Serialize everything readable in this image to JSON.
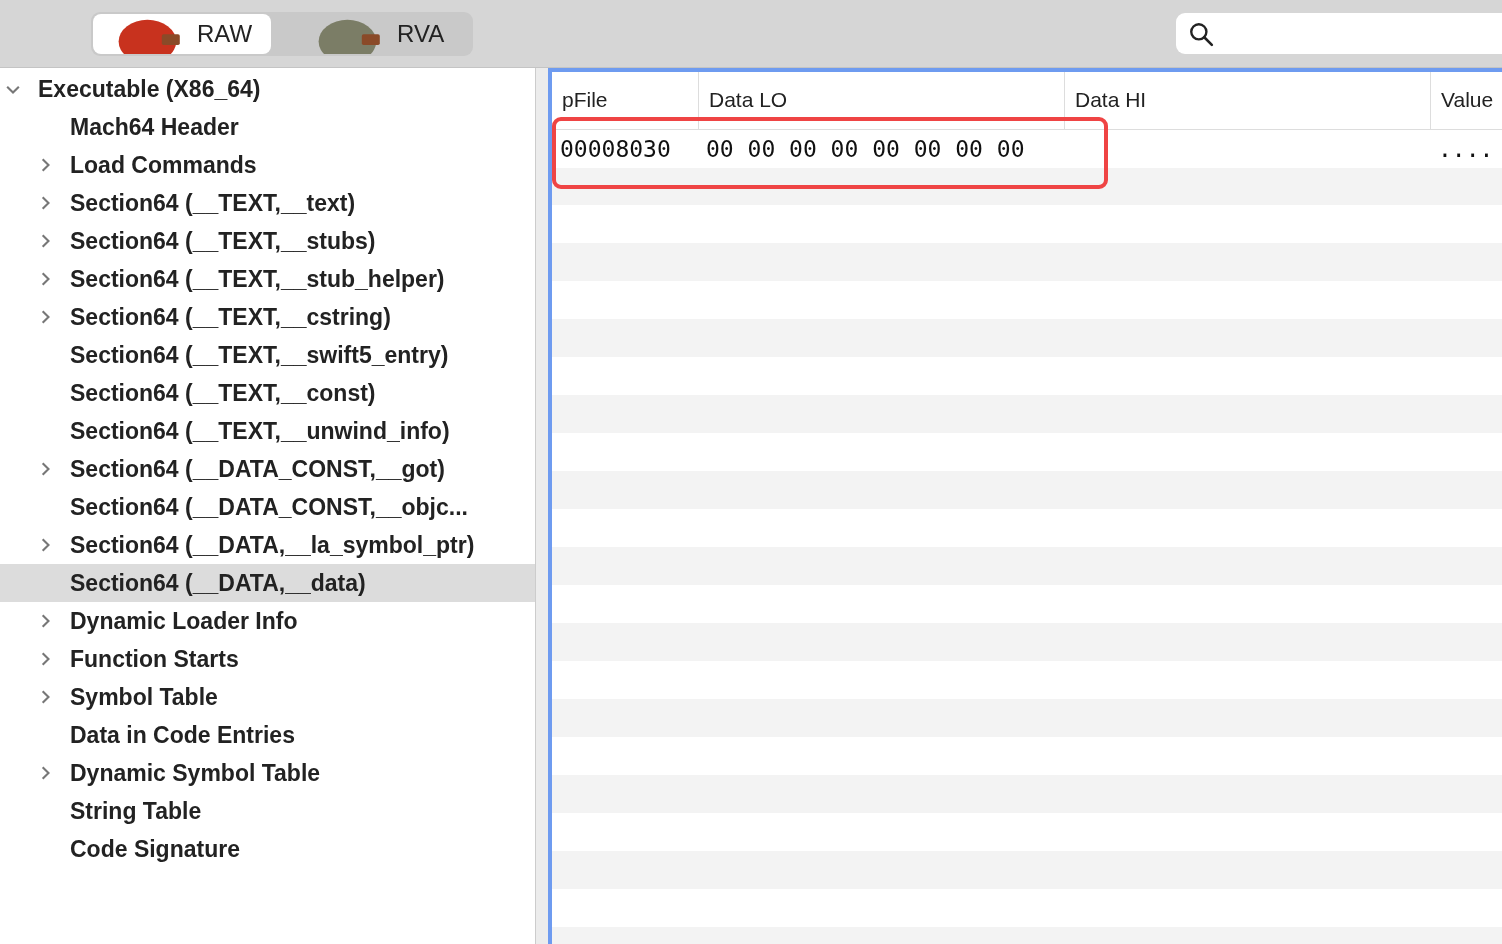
{
  "toolbar": {
    "segments": [
      {
        "label": "RAW",
        "selected": true
      },
      {
        "label": "RVA",
        "selected": false
      }
    ]
  },
  "tree": [
    {
      "label": "Executable  (X86_64)",
      "expanded": true,
      "selected": false,
      "children": [
        {
          "label": "Mach64 Header",
          "selected": false
        },
        {
          "label": "Load Commands",
          "expanded": false,
          "selected": false
        },
        {
          "label": "Section64 (__TEXT,__text)",
          "expanded": false,
          "selected": false
        },
        {
          "label": "Section64 (__TEXT,__stubs)",
          "expanded": false,
          "selected": false
        },
        {
          "label": "Section64 (__TEXT,__stub_helper)",
          "expanded": false,
          "selected": false
        },
        {
          "label": "Section64 (__TEXT,__cstring)",
          "expanded": false,
          "selected": false
        },
        {
          "label": "Section64 (__TEXT,__swift5_entry)",
          "selected": false
        },
        {
          "label": "Section64 (__TEXT,__const)",
          "selected": false
        },
        {
          "label": "Section64 (__TEXT,__unwind_info)",
          "selected": false
        },
        {
          "label": "Section64 (__DATA_CONST,__got)",
          "expanded": false,
          "selected": false
        },
        {
          "label": "Section64 (__DATA_CONST,__objc...",
          "selected": false
        },
        {
          "label": "Section64 (__DATA,__la_symbol_ptr)",
          "expanded": false,
          "selected": false
        },
        {
          "label": "Section64 (__DATA,__data)",
          "selected": true
        },
        {
          "label": "Dynamic Loader Info",
          "expanded": false,
          "selected": false
        },
        {
          "label": "Function Starts",
          "expanded": false,
          "selected": false
        },
        {
          "label": "Symbol Table",
          "expanded": false,
          "selected": false
        },
        {
          "label": "Data in Code Entries",
          "selected": false
        },
        {
          "label": "Dynamic Symbol Table",
          "expanded": false,
          "selected": false
        },
        {
          "label": "String Table",
          "selected": false
        },
        {
          "label": "Code Signature",
          "selected": false
        }
      ]
    }
  ],
  "table": {
    "columns": [
      "pFile",
      "Data LO",
      "Data HI",
      "Value"
    ],
    "rows": [
      {
        "cells": [
          "00008030",
          "00 00 00 00 00 00 00 00",
          "",
          "...."
        ],
        "highlighted": true
      }
    ]
  }
}
